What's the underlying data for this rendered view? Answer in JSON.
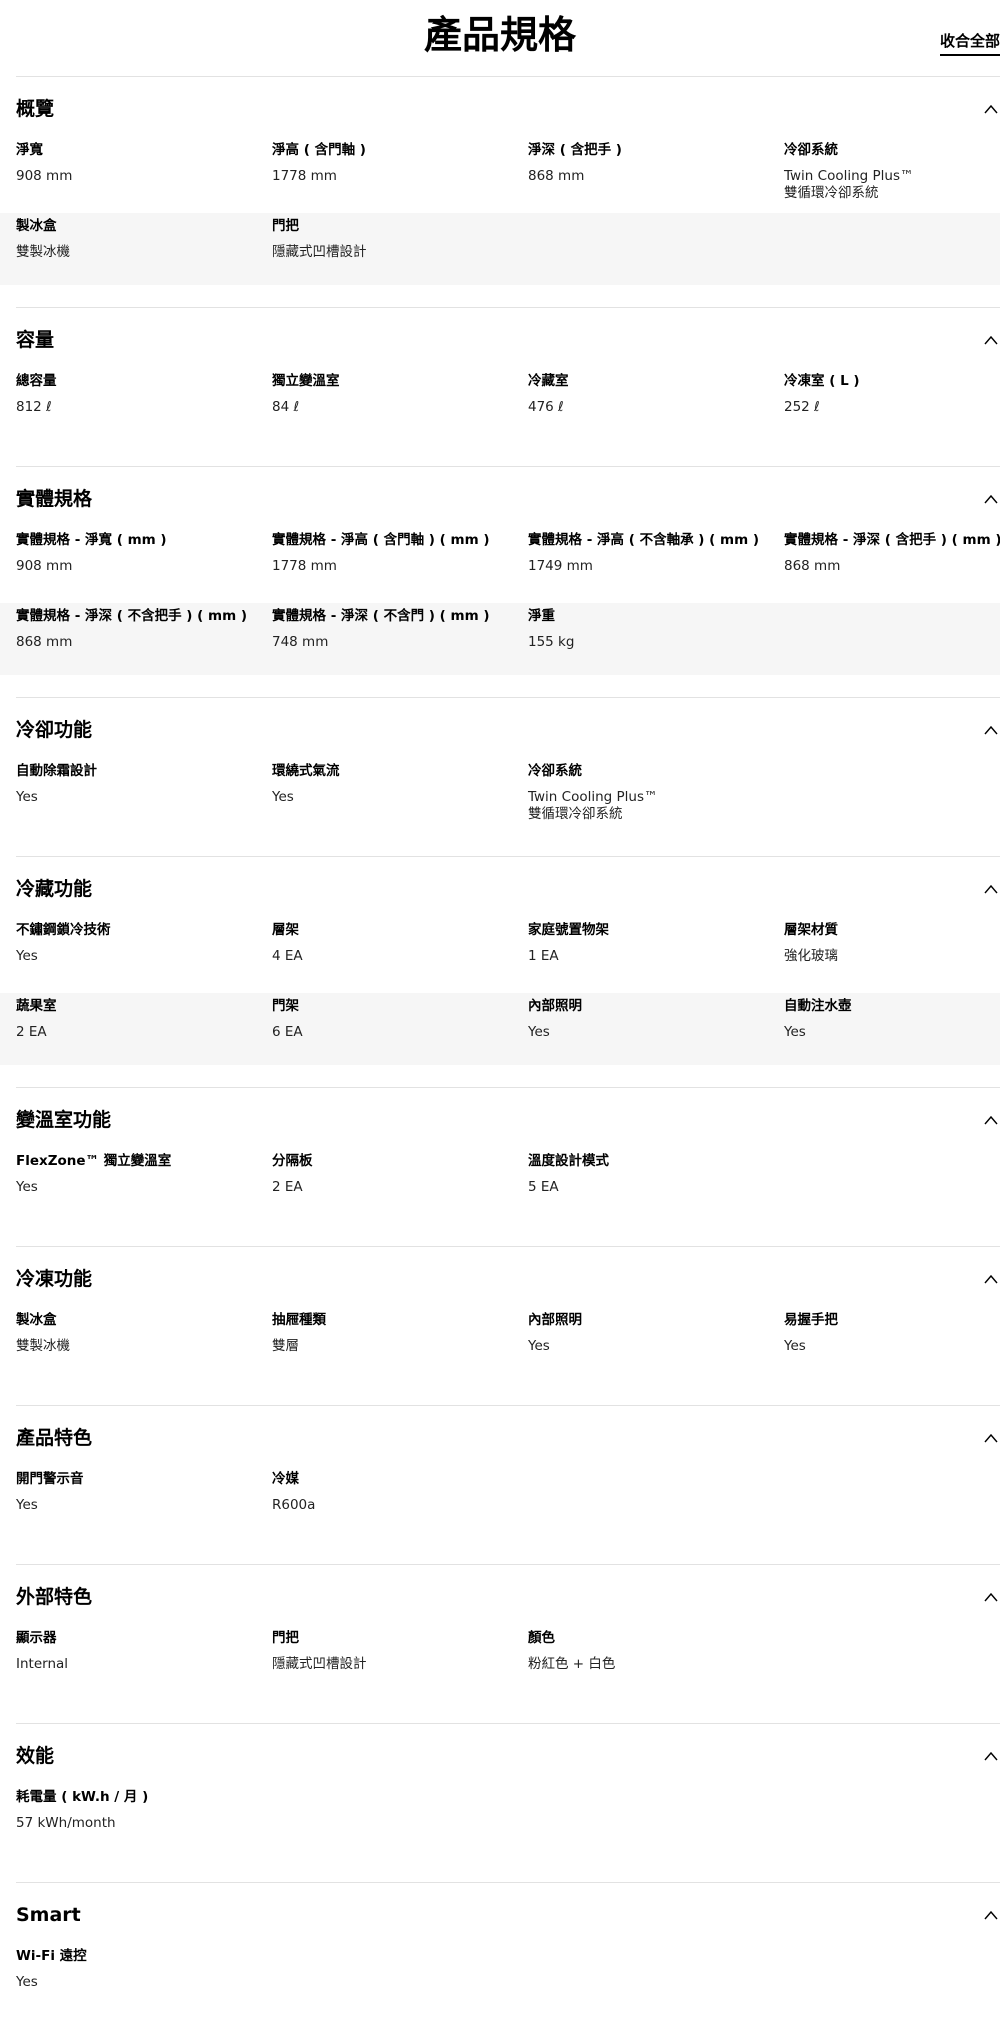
{
  "page": {
    "title": "產品規格",
    "collapse_all": "收合全部"
  },
  "sections": [
    {
      "title": "概覽",
      "rows": [
        [
          {
            "label": "淨寬",
            "value": [
              "908 mm"
            ]
          },
          {
            "label": "淨高 ( 含門軸 )",
            "value": [
              "1778 mm"
            ]
          },
          {
            "label": "淨深 ( 含把手 )",
            "value": [
              "868 mm"
            ]
          },
          {
            "label": "冷卻系統",
            "value": [
              "Twin Cooling Plus™",
              "雙循環冷卻系統"
            ]
          }
        ],
        [
          {
            "label": "製冰盒",
            "value": [
              "雙製冰機"
            ]
          },
          {
            "label": "門把",
            "value": [
              "隱藏式凹槽設計"
            ]
          }
        ]
      ]
    },
    {
      "title": "容量",
      "rows": [
        [
          {
            "label": "總容量",
            "value": [
              "812 ℓ"
            ]
          },
          {
            "label": "獨立變溫室",
            "value": [
              "84 ℓ"
            ]
          },
          {
            "label": "冷藏室",
            "value": [
              "476 ℓ"
            ]
          },
          {
            "label": "冷凍室 ( L )",
            "value": [
              "252 ℓ"
            ]
          }
        ]
      ]
    },
    {
      "title": "實體規格",
      "rows": [
        [
          {
            "label": "實體規格 - 淨寬 ( mm )",
            "value": [
              "908 mm"
            ]
          },
          {
            "label": "實體規格 - 淨高 ( 含門軸 ) ( mm )",
            "value": [
              "1778 mm"
            ]
          },
          {
            "label": "實體規格 - 淨高 ( 不含軸承 ) ( mm )",
            "value": [
              "1749 mm"
            ]
          },
          {
            "label": "實體規格 - 淨深 ( 含把手 ) ( mm )",
            "value": [
              "868 mm"
            ]
          }
        ],
        [
          {
            "label": "實體規格 - 淨深 ( 不含把手 ) ( mm )",
            "value": [
              "868 mm"
            ]
          },
          {
            "label": "實體規格 - 淨深 ( 不含門 ) ( mm )",
            "value": [
              "748 mm"
            ]
          },
          {
            "label": "淨重",
            "value": [
              "155 kg"
            ]
          }
        ]
      ]
    },
    {
      "title": "冷卻功能",
      "rows": [
        [
          {
            "label": "自動除霜設計",
            "value": [
              "Yes"
            ]
          },
          {
            "label": "環繞式氣流",
            "value": [
              "Yes"
            ]
          },
          {
            "label": "冷卻系統",
            "value": [
              "Twin Cooling Plus™",
              "雙循環冷卻系統"
            ]
          }
        ]
      ]
    },
    {
      "title": "冷藏功能",
      "rows": [
        [
          {
            "label": "不鏽鋼鎖冷技術",
            "value": [
              "Yes"
            ]
          },
          {
            "label": "層架",
            "value": [
              "4 EA"
            ]
          },
          {
            "label": "家庭號置物架",
            "value": [
              "1 EA"
            ]
          },
          {
            "label": "層架材質",
            "value": [
              "強化玻璃"
            ]
          }
        ],
        [
          {
            "label": "蔬果室",
            "value": [
              "2 EA"
            ]
          },
          {
            "label": "門架",
            "value": [
              "6 EA"
            ]
          },
          {
            "label": "內部照明",
            "value": [
              "Yes"
            ]
          },
          {
            "label": "自動注水壺",
            "value": [
              "Yes"
            ]
          }
        ]
      ]
    },
    {
      "title": "變溫室功能",
      "rows": [
        [
          {
            "label": "FlexZone™ 獨立變溫室",
            "value": [
              "Yes"
            ]
          },
          {
            "label": "分隔板",
            "value": [
              "2 EA"
            ]
          },
          {
            "label": "溫度設計模式",
            "value": [
              "5 EA"
            ]
          }
        ]
      ]
    },
    {
      "title": "冷凍功能",
      "rows": [
        [
          {
            "label": "製冰盒",
            "value": [
              "雙製冰機"
            ]
          },
          {
            "label": "抽屜種類",
            "value": [
              "雙層"
            ]
          },
          {
            "label": "內部照明",
            "value": [
              "Yes"
            ]
          },
          {
            "label": "易握手把",
            "value": [
              "Yes"
            ]
          }
        ]
      ]
    },
    {
      "title": "產品特色",
      "rows": [
        [
          {
            "label": "開門警示音",
            "value": [
              "Yes"
            ]
          },
          {
            "label": "冷媒",
            "value": [
              "R600a"
            ]
          }
        ]
      ]
    },
    {
      "title": "外部特色",
      "rows": [
        [
          {
            "label": "顯示器",
            "value": [
              "Internal"
            ]
          },
          {
            "label": "門把",
            "value": [
              "隱藏式凹槽設計"
            ]
          },
          {
            "label": "顏色",
            "value": [
              "粉紅色 + 白色"
            ]
          }
        ]
      ]
    },
    {
      "title": "效能",
      "rows": [
        [
          {
            "label": "耗電量 ( kW.h / 月 )",
            "value": [
              "57 kWh/month"
            ]
          }
        ]
      ]
    },
    {
      "title": "Smart",
      "rows": [
        [
          {
            "label": "Wi-Fi 遠控",
            "value": [
              "Yes"
            ]
          }
        ]
      ]
    }
  ]
}
